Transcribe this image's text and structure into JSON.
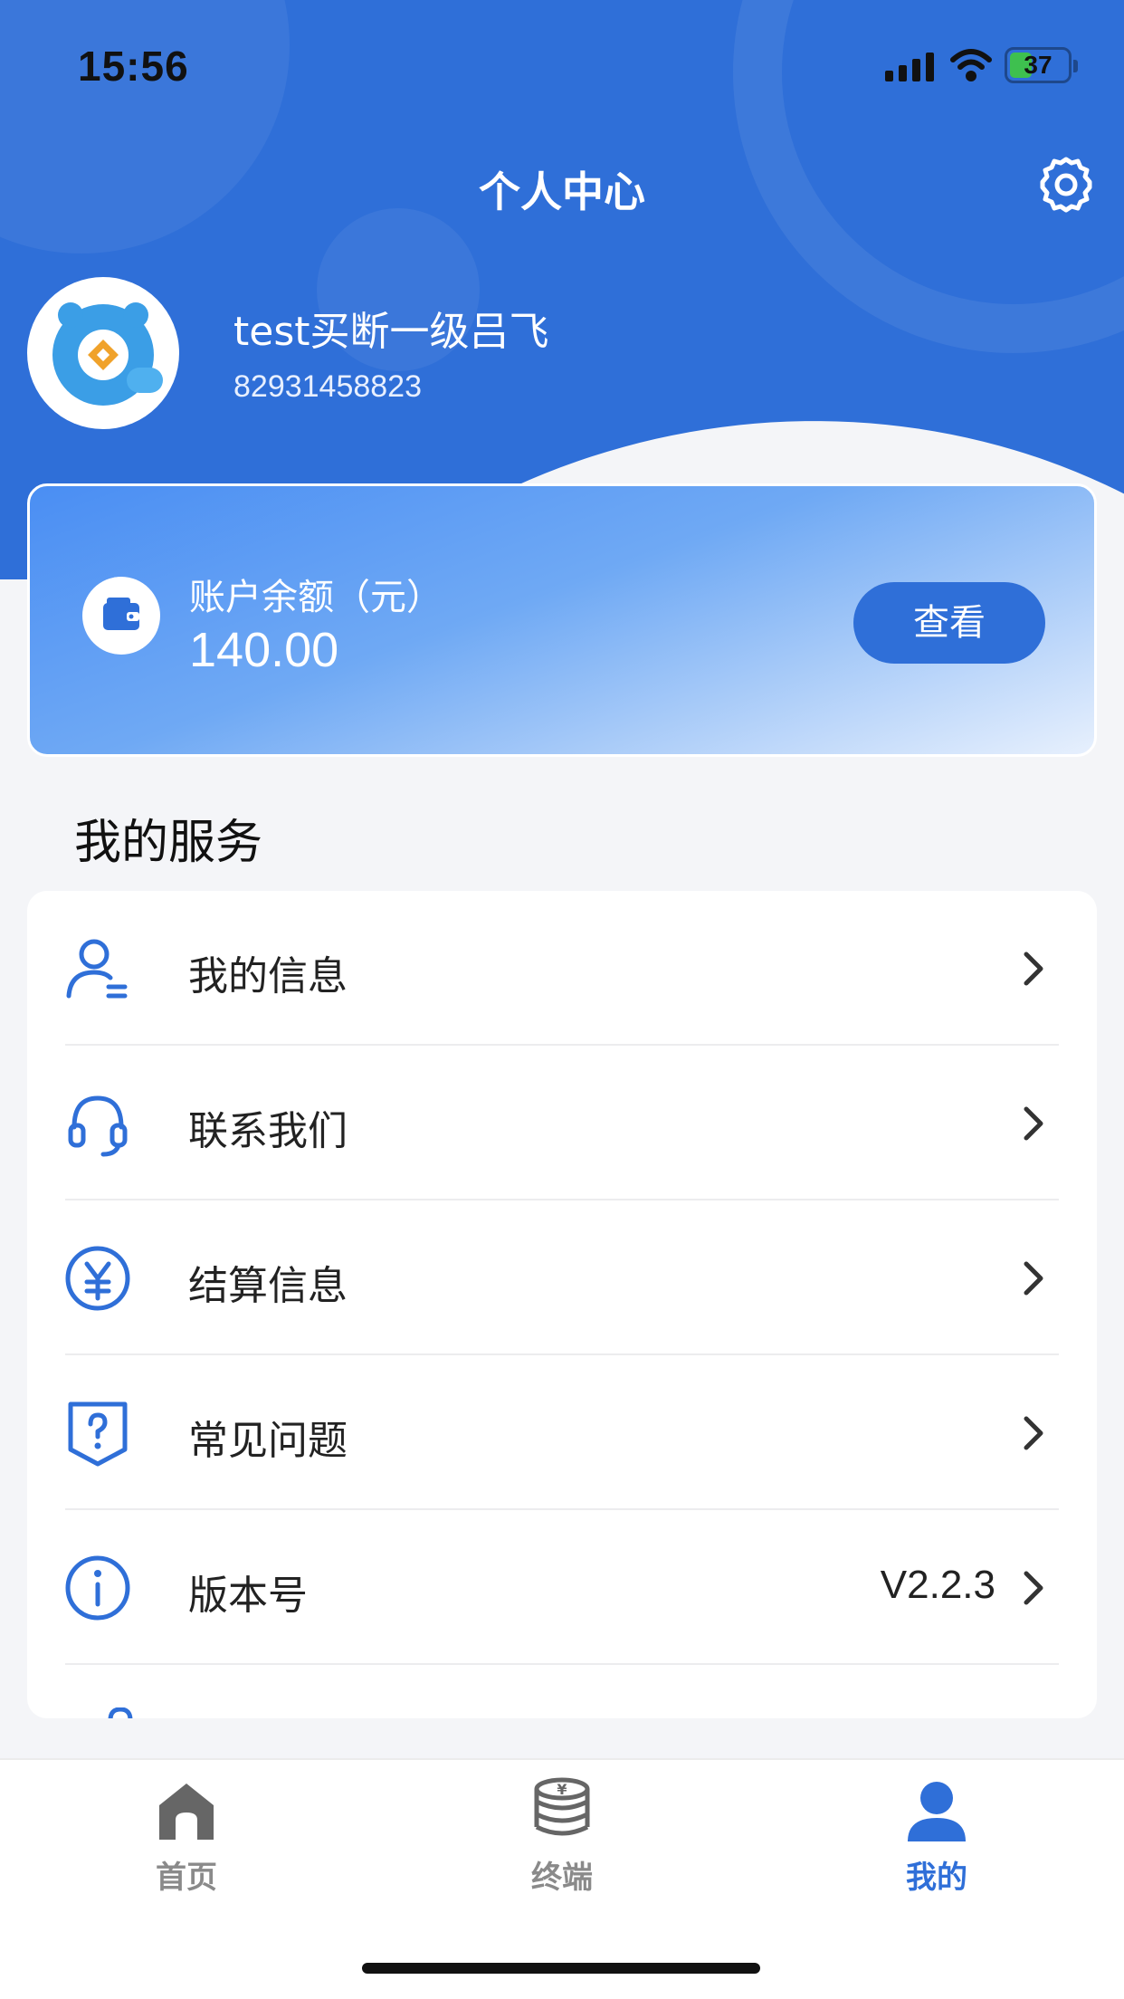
{
  "status_bar": {
    "time": "15:56",
    "battery": "37"
  },
  "header": {
    "title": "个人中心"
  },
  "user": {
    "name": "test买断一级吕飞",
    "id": "82931458823"
  },
  "balance": {
    "label": "账户余额（元）",
    "value": "140.00",
    "button": "查看"
  },
  "services": {
    "title": "我的服务",
    "items": [
      {
        "label": "我的信息",
        "icon": "user-info-icon"
      },
      {
        "label": "联系我们",
        "icon": "headset-icon"
      },
      {
        "label": "结算信息",
        "icon": "yen-icon"
      },
      {
        "label": "常见问题",
        "icon": "question-icon"
      },
      {
        "label": "版本号",
        "icon": "info-icon",
        "value": "V2.2.3"
      }
    ]
  },
  "tabbar": {
    "items": [
      {
        "label": "首页",
        "icon": "home-icon"
      },
      {
        "label": "终端",
        "icon": "coins-icon"
      },
      {
        "label": "我的",
        "icon": "person-icon",
        "active": true
      }
    ]
  },
  "colors": {
    "brand": "#2f6fd8",
    "background": "#f4f5f8",
    "tab_inactive": "#8a8a8a"
  }
}
